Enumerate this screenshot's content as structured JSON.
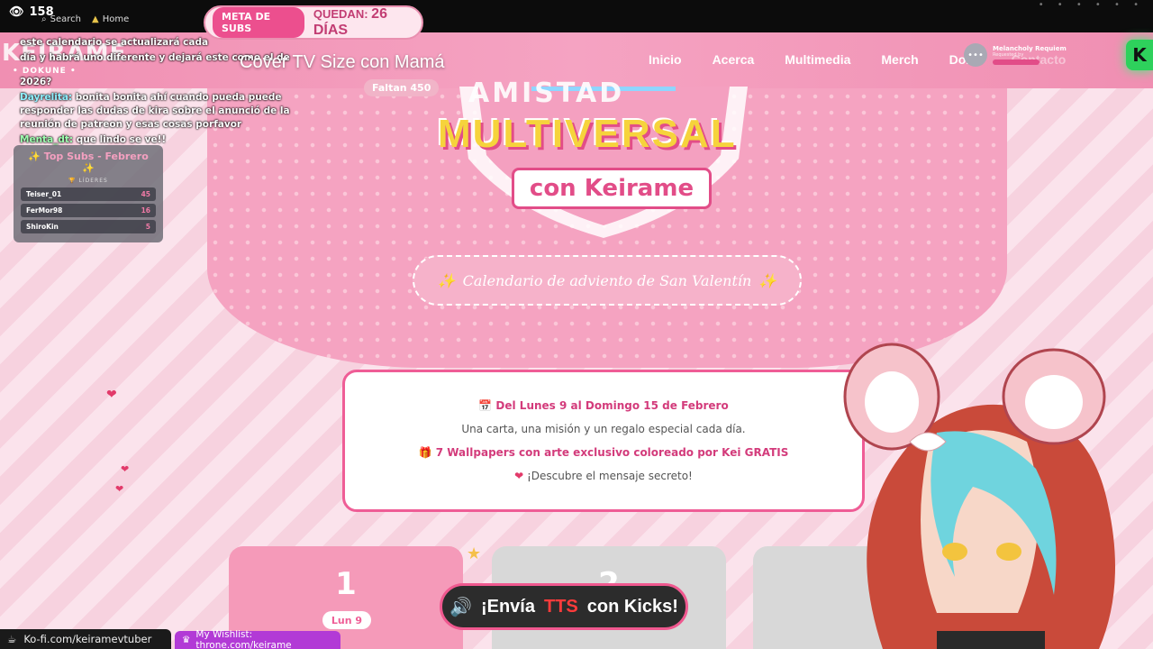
{
  "browser": {
    "viewers": "158",
    "search_label": "Search",
    "home_label": "Home"
  },
  "sub_goal": {
    "pill": "META DE SUBS",
    "remaining_label": "QUEDAN:",
    "remaining_value": "26 DÍAS"
  },
  "nav": {
    "logo": "KEIRAME",
    "tagline": "• DOKUNE •",
    "links": [
      "Inicio",
      "Acerca",
      "Multimedia",
      "Merch",
      "Dona",
      "Contacto"
    ],
    "k_badge": "K"
  },
  "music": {
    "title": "Melancholy Requiem",
    "subtitle": "Requested by"
  },
  "song": {
    "title": "Cover TV Size con Mamá",
    "faltan": "Faltan 450"
  },
  "chat": {
    "messages": [
      {
        "user": "",
        "text": "este calendario se actualizará cada"
      },
      {
        "user": "",
        "text": "día y habrá uno diferente y dejará este como el de"
      },
      {
        "user": "",
        "text": "2026?"
      },
      {
        "user": "Dayrelita:",
        "text": "bonita bonita ahí cuando pueda puede responder las dudas de kira sobre el anunció de la reunión de patreon y esas cosas porfavor"
      },
      {
        "user": "Menta_dt:",
        "text": "que lindo se ve!!"
      }
    ]
  },
  "top_subs": {
    "title": "✨ Top Subs - Febrero ✨",
    "subtitle": "🏆 LÍDERES",
    "rows": [
      {
        "name": "Teiser_01",
        "count": "45"
      },
      {
        "name": "FerMor98",
        "count": "16"
      },
      {
        "name": "ShiroKin",
        "count": "5"
      }
    ]
  },
  "banner": {
    "title_top": "AMISTAD",
    "title_main": "MULTIVERSAL",
    "title_sub": "con Keirame",
    "pill": "Calendario de adviento de San Valentín"
  },
  "info": {
    "dates": "Del Lunes 9 al Domingo 15 de Febrero",
    "desc": "Una carta, una misión y un regalo especial cada día.",
    "wallpapers": "7 Wallpapers con arte exclusivo coloreado por Kei GRATIS",
    "secret": "¡Descubre el mensaje secreto!"
  },
  "days": [
    {
      "num": "1",
      "label": "Lun 9"
    },
    {
      "num": "2",
      "label": ""
    },
    {
      "num": "",
      "label": ""
    }
  ],
  "tts": {
    "pre": "¡Envía",
    "red": "TTS",
    "post": "con Kicks!"
  },
  "bottom": {
    "kofi": "Ko-fi.com/keiramevtuber",
    "wishlist": "My Wishlist: throne.com/keirame"
  },
  "colors": {
    "accent": "#ef5d96",
    "nav_bg": "#f5a3c2",
    "kick_green": "#2ed15c"
  }
}
